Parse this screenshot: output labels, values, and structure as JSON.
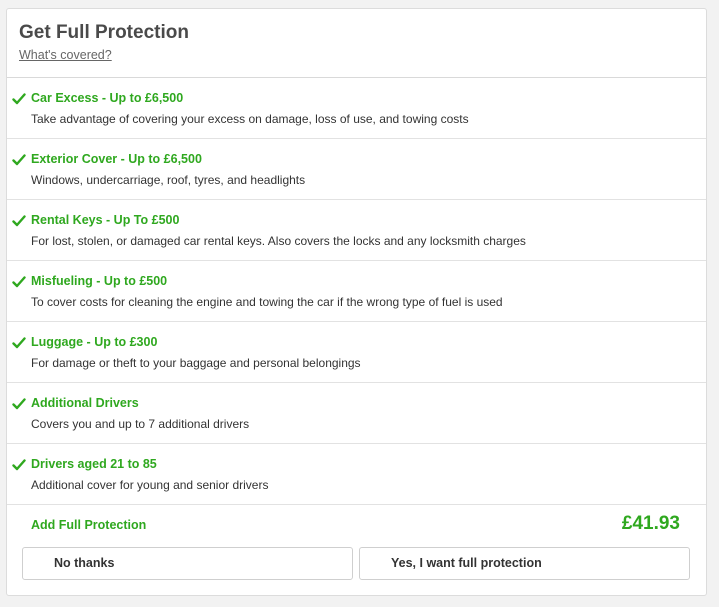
{
  "header": {
    "title": "Get Full Protection",
    "covered_link": "What's covered?"
  },
  "items": [
    {
      "title": "Car Excess - Up to £6,500",
      "description": "Take advantage of covering your excess on damage, loss of use, and towing costs"
    },
    {
      "title": "Exterior Cover - Up to £6,500",
      "description": "Windows, undercarriage, roof, tyres, and headlights"
    },
    {
      "title": "Rental Keys - Up To £500",
      "description": "For lost, stolen, or damaged car rental keys. Also covers the locks and any locksmith charges"
    },
    {
      "title": "Misfueling - Up to £500",
      "description": "To cover costs for cleaning the engine and towing the car if the wrong type of fuel is used"
    },
    {
      "title": "Luggage - Up to £300",
      "description": "For damage or theft to your baggage and personal belongings"
    },
    {
      "title": "Additional Drivers",
      "description": "Covers you and up to 7 additional drivers"
    },
    {
      "title": "Drivers aged 21 to 85",
      "description": "Additional cover for young and senior drivers"
    }
  ],
  "footer": {
    "add_label": "Add Full Protection",
    "price": "£41.93",
    "no_button": "No thanks",
    "yes_button": "Yes, I want full protection"
  },
  "colors": {
    "accent_green": "#2fa81f",
    "text": "#333333"
  },
  "icons": {
    "item_icon": "checkmark-icon"
  }
}
